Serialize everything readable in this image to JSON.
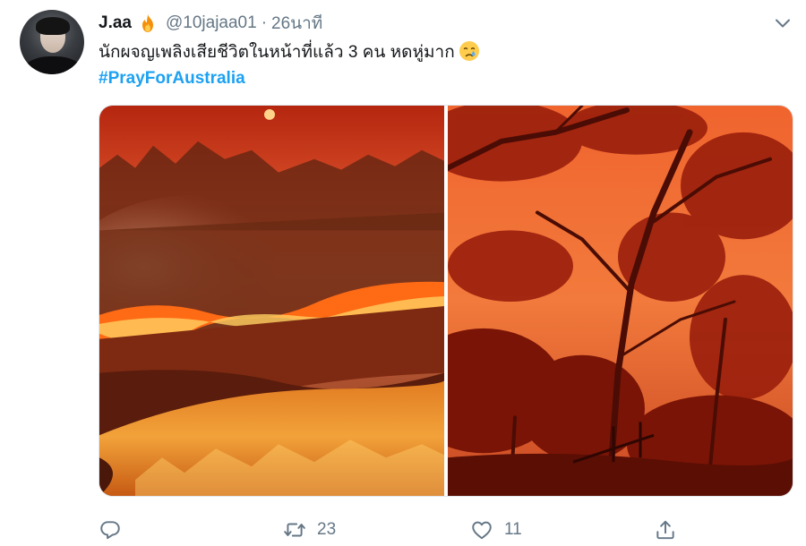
{
  "tweet": {
    "author_name": "J.aa",
    "author_handle": "@10jajaa01",
    "separator": "·",
    "timestamp": "26นาที",
    "text": "นักผจญเพลิงเสียชีวิตในหน้าที่แล้ว 3 คน หดหู่มาก",
    "hashtag": "#PrayForAustralia",
    "retweet_count": "23",
    "like_count": "11"
  },
  "icons": {
    "name_badge": "fire-icon",
    "text_emoji": "crying-face-icon",
    "menu": "chevron-down-icon",
    "reply": "reply-icon",
    "retweet": "retweet-icon",
    "like": "heart-icon",
    "share": "share-icon"
  },
  "colors": {
    "link": "#1da1f2",
    "secondary_text": "#657786",
    "primary_text": "#14171a"
  }
}
